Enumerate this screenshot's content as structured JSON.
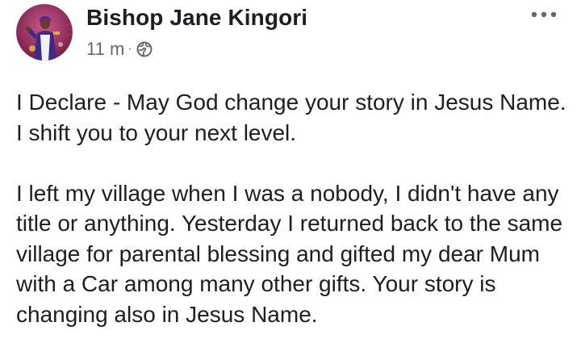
{
  "post": {
    "author": "Bishop Jane Kingori",
    "time": "11 m",
    "separator": "·",
    "privacy_icon": "globe-icon",
    "more_icon": "more-options-icon",
    "avatar_icon": "profile-photo",
    "paragraphs": [
      "I Declare - May God change your story in Jesus Name. I shift you to your next level.",
      "I left my village when I was a nobody, I didn't have any title or anything. Yesterday I returned back to the same village for parental blessing and gifted my dear Mum with a Car among many other gifts. Your story is changing also in Jesus Name."
    ]
  },
  "colors": {
    "text": "#1c1e21",
    "secondary": "#65676b",
    "background": "#ffffff"
  }
}
